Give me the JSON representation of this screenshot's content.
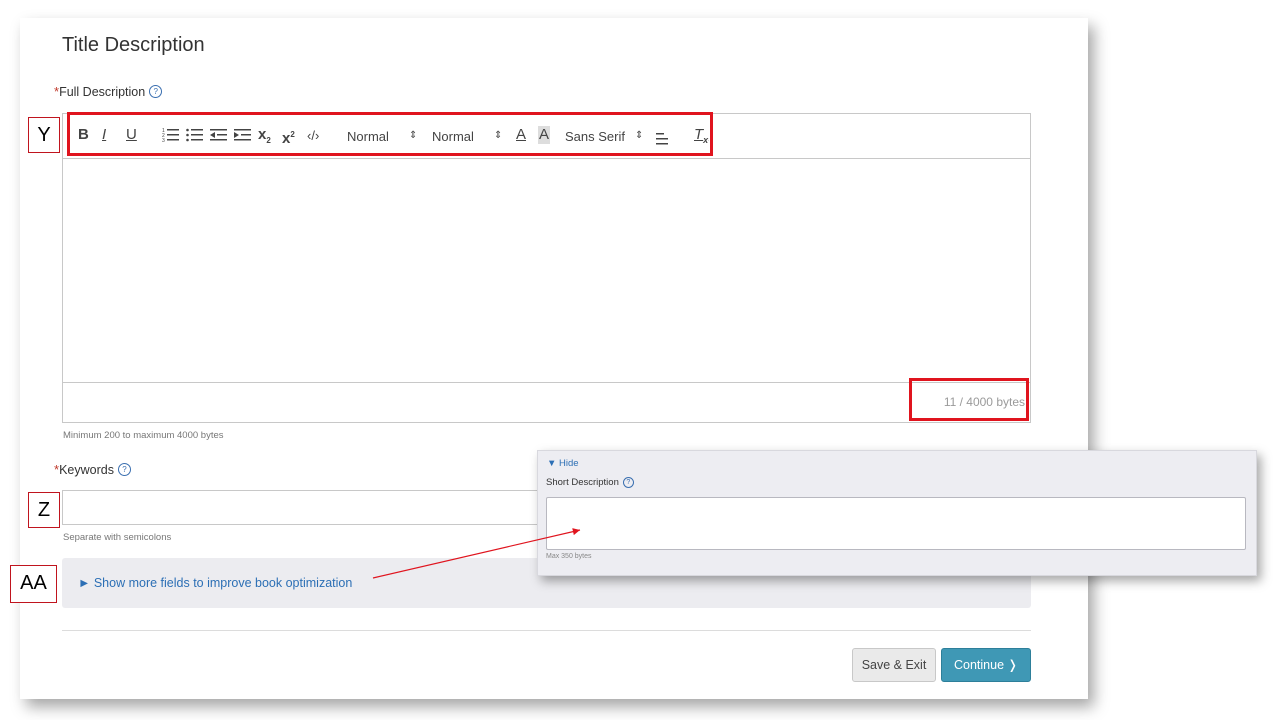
{
  "page": {
    "title": "Title Description"
  },
  "full_description": {
    "required_mark": "*",
    "label": "Full Description",
    "help_icon": "?",
    "byte_count": "11 / 4000 bytes",
    "hint": "Minimum 200 to maximum 4000 bytes"
  },
  "toolbar": {
    "bold": "B",
    "italic": "I",
    "underline": "U",
    "subscript": "x",
    "subscript_mark": "2",
    "superscript": "x",
    "superscript_mark": "2",
    "code": "‹/›",
    "header_select": "Normal",
    "size_select": "Normal",
    "font_color": "A",
    "font_bg": "A",
    "font_family": "Sans Serif",
    "clear": "T",
    "clear_mark": "x",
    "select_arrow": "⇕"
  },
  "keywords": {
    "required_mark": "*",
    "label": "Keywords",
    "help_icon": "?",
    "hint": "Separate with semicolons",
    "value": ""
  },
  "more_fields": {
    "link": "► Show more fields to improve book optimization"
  },
  "buttons": {
    "save_exit": "Save & Exit",
    "continue": "Continue ❭"
  },
  "callouts": {
    "y": "Y",
    "z": "Z",
    "aa": "AA"
  },
  "inset": {
    "hide": "▼ Hide",
    "label": "Short Description",
    "help_icon": "?",
    "max": "Max 350 bytes",
    "value": ""
  },
  "colors": {
    "callout_red": "#e0141e",
    "link_blue": "#2c6fb5",
    "continue_teal": "#3f98b5"
  }
}
